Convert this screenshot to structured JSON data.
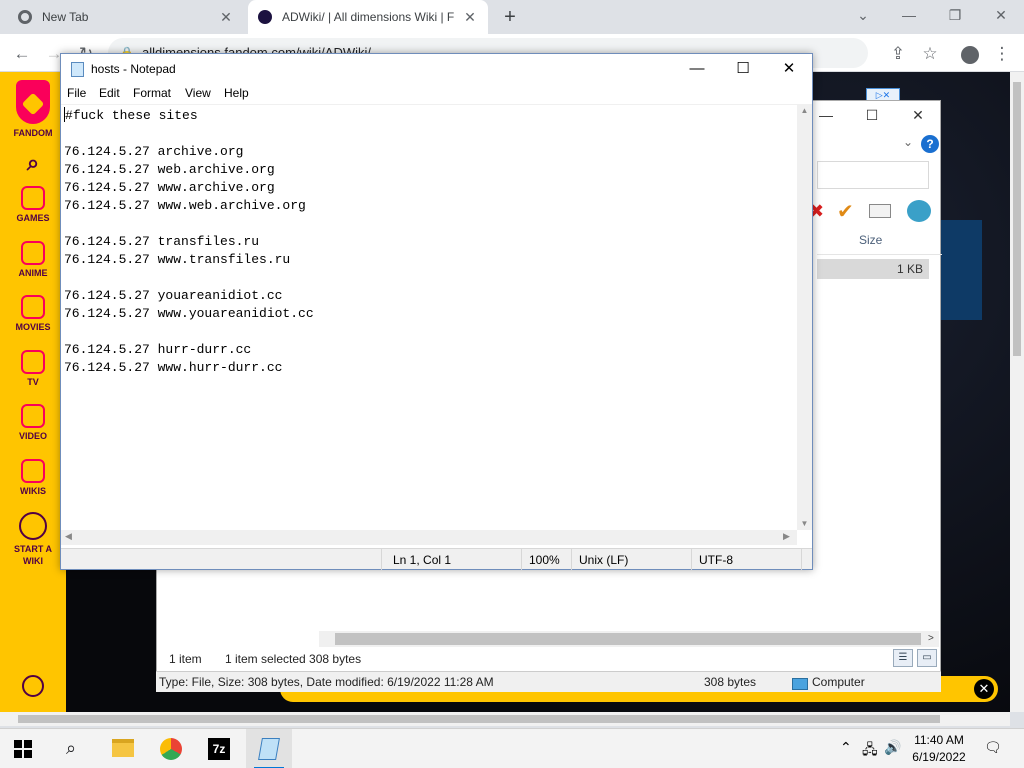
{
  "browser": {
    "tabs": [
      {
        "label": "New Tab",
        "icon": "chrome-icon",
        "active": false
      },
      {
        "label": "ADWiki/ | All dimensions Wiki | F",
        "icon": "fandom-favicon",
        "active": true
      }
    ],
    "url": "alldimensions.fandom.com/wiki/ADWiki/"
  },
  "fandom_rail": {
    "logo_label": "FANDOM",
    "items": [
      {
        "label": "GAMES",
        "icon": "gamepad-icon"
      },
      {
        "label": "ANIME",
        "icon": "anime-face-icon"
      },
      {
        "label": "MOVIES",
        "icon": "clapperboard-icon"
      },
      {
        "label": "TV",
        "icon": "tv-icon"
      },
      {
        "label": "VIDEO",
        "icon": "play-icon"
      },
      {
        "label": "WIKIS",
        "icon": "book-icon"
      },
      {
        "label": "START A WIKI",
        "icon": "plus-circle-icon"
      }
    ]
  },
  "explorer": {
    "column_size": "Size",
    "row_size": "1 KB",
    "status_items": "1 item",
    "status_selected": "1 item selected  308 bytes",
    "detail_text": "Type: File, Size: 308 bytes, Date modified: 6/19/2022 11:28 AM",
    "detail_size": "308 bytes",
    "detail_location": "Computer"
  },
  "notepad": {
    "title": "hosts - Notepad",
    "menu": [
      "File",
      "Edit",
      "Format",
      "View",
      "Help"
    ],
    "content": "fuck these sites\n\n76.124.5.27 archive.org\n76.124.5.27 web.archive.org\n76.124.5.27 www.archive.org\n76.124.5.27 www.web.archive.org\n\n76.124.5.27 transfiles.ru\n76.124.5.27 www.transfiles.ru\n\n76.124.5.27 youareanidiot.cc\n76.124.5.27 www.youareanidiot.cc\n\n76.124.5.27 hurr-durr.cc\n76.124.5.27 www.hurr-durr.cc",
    "content_prefix": "#",
    "status": {
      "position": "Ln 1, Col 1",
      "zoom": "100%",
      "line_ending": "Unix (LF)",
      "encoding": "UTF-8"
    }
  },
  "taskbar": {
    "apps": [
      "file-explorer-icon",
      "chrome-icon",
      "7zip-icon",
      "notepad-icon"
    ],
    "app_7z_label": "7z",
    "time": "11:40 AM",
    "date": "6/19/2022"
  }
}
